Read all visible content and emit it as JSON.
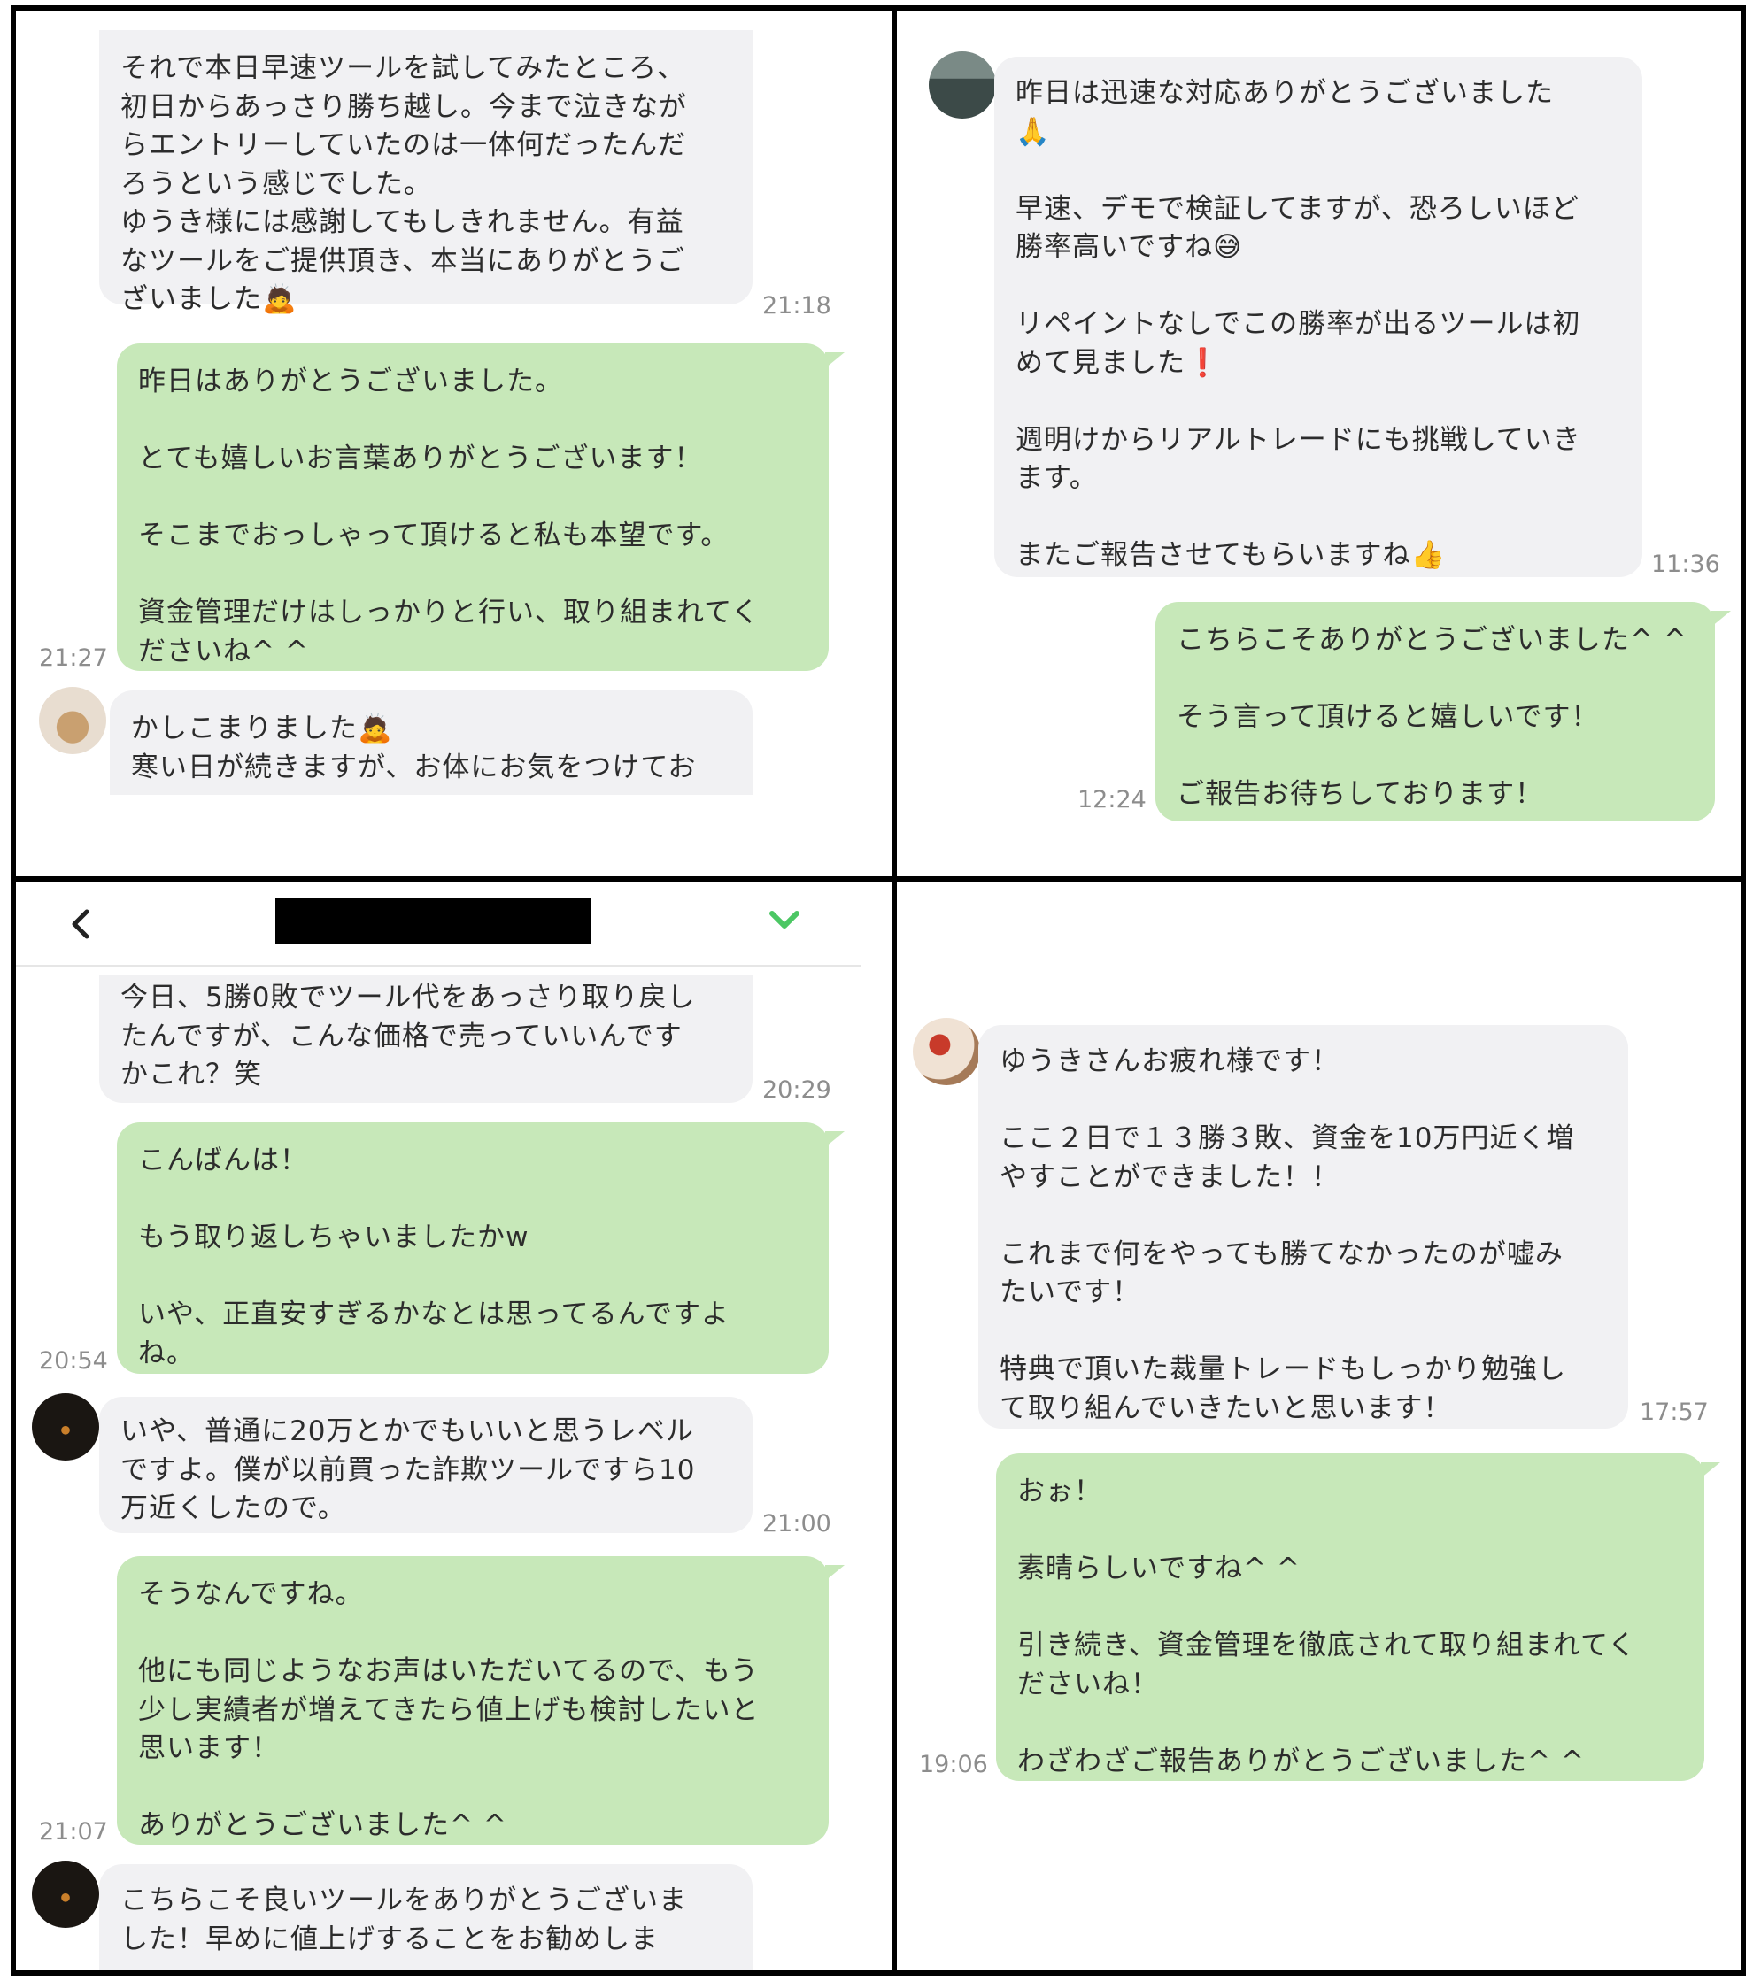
{
  "panels": {
    "top_left": {
      "messages": [
        {
          "text": "それで本日早速ツールを試してみたところ、\n初日からあっさり勝ち越し。今まで泣きなが\nらエントリーしていたのは一体何だったんだ\nろうという感じでした。\nゆうき様には感謝してもしきれません。有益\nなツールをご提供頂き、本当にありがとうご\nざいました🙇",
          "time": "21:18"
        },
        {
          "text": "昨日はありがとうございました。\n\nとても嬉しいお言葉ありがとうございます！\n\nそこまでおっしゃって頂けると私も本望です。\n\n資金管理だけはしっかりと行い、取り組まれてく\nださいね^ ^",
          "time": "21:27"
        },
        {
          "text": "かしこまりました🙇\n寒い日が続きますが、お体にお気をつけてお"
        }
      ]
    },
    "top_right": {
      "messages": [
        {
          "text": "昨日は迅速な対応ありがとうございました\n🙏\n\n早速、デモで検証してますが、恐ろしいほど\n勝率高いですね😅\n\nリペイントなしでこの勝率が出るツールは初\nめて見ました❗\n\n週明けからリアルトレードにも挑戦していき\nます。\n\nまたご報告させてもらいますね👍",
          "time": "11:36"
        },
        {
          "text": "こちらこそありがとうございました^ ^\n\nそう言って頂けると嬉しいです！\n\nご報告お待ちしております！",
          "time": "12:24"
        }
      ]
    },
    "bottom_left": {
      "messages": [
        {
          "text": "今日、5勝0敗でツール代をあっさり取り戻し\nたんですが、こんな価格で売っていいんです\nかこれ？笑",
          "time": "20:29"
        },
        {
          "text": "こんばんは！\n\nもう取り返しちゃいましたかw\n\nいや、正直安すぎるかなとは思ってるんですよ\nね。",
          "time": "20:54"
        },
        {
          "text": "いや、普通に20万とかでもいいと思うレベル\nですよ。僕が以前買った詐欺ツールですら10\n万近くしたので。",
          "time": "21:00"
        },
        {
          "text": "そうなんですね。\n\n他にも同じようなお声はいただいてるので、もう\n少し実績者が増えてきたら値上げも検討したいと\n思います！\n\nありがとうございました^ ^",
          "time": "21:07"
        },
        {
          "text": "こちらこそ良いツールをありがとうございま\nした！早めに値上げすることをお勧めしま"
        }
      ]
    },
    "bottom_right": {
      "messages": [
        {
          "text": "ゆうきさんお疲れ様です！\n\nここ２日で１３勝３敗、資金を10万円近く増\nやすことができました！！\n\nこれまで何をやっても勝てなかったのが嘘み\nたいです！\n\n特典で頂いた裁量トレードもしっかり勉強し\nて取り組んでいきたいと思います！",
          "time": "17:57"
        },
        {
          "text": "おぉ！\n\n素晴らしいですね^ ^\n\n引き続き、資金管理を徹底されて取り組まれてく\nださいね！\n\nわざわざご報告ありがとうございました^ ^",
          "time": "19:06"
        }
      ]
    }
  },
  "colors": {
    "incoming_bubble": "#f1f1f3",
    "outgoing_bubble": "#c7e8b9",
    "timestamp": "#8d8d8d",
    "check_icon": "#4cc764"
  },
  "icons": {
    "back": "chevron-left-icon",
    "confirm": "check-icon"
  }
}
